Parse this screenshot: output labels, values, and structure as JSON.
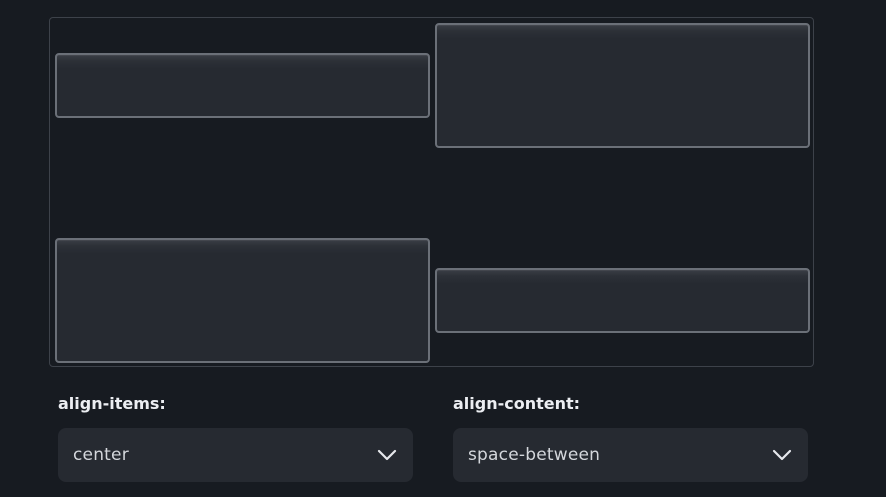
{
  "controls": {
    "align_items": {
      "label": "align-items:",
      "value": "center"
    },
    "align_content": {
      "label": "align-content:",
      "value": "space-between"
    }
  },
  "icons": {
    "dropdown": "chevron-down-icon"
  },
  "colors": {
    "background": "#171b21",
    "item_border": "#6b7078",
    "select_background": "#262a31"
  }
}
